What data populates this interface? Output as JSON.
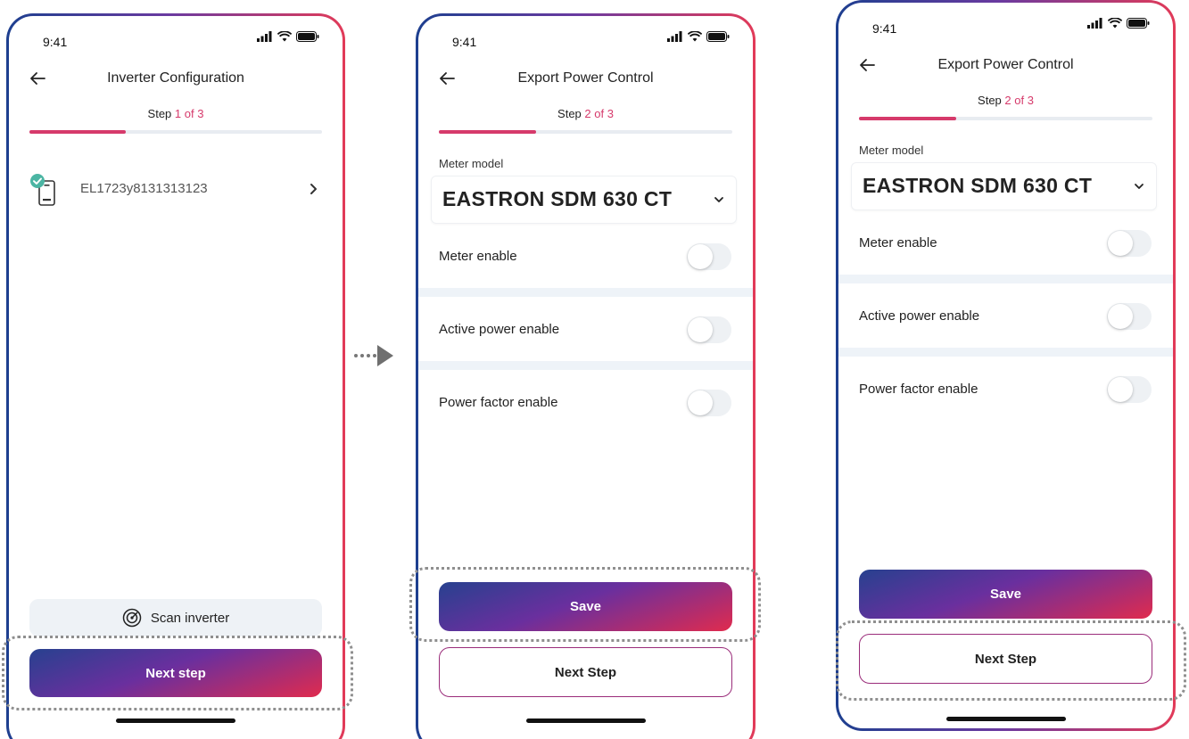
{
  "status_bar": {
    "time": "9:41"
  },
  "screen1": {
    "title": "Inverter Configuration",
    "step_prefix": "Step",
    "step_value": "1 of 3",
    "progress_fraction": 0.33,
    "device": {
      "id": "EL1723y8131313123"
    },
    "scan_button": "Scan inverter",
    "next_button": "Next step"
  },
  "screen2": {
    "title": "Export Power Control",
    "step_prefix": "Step",
    "step_value": "2 of 3",
    "progress_fraction": 0.33,
    "meter_label": "Meter model",
    "meter_value": "EASTRON SDM 630 CT",
    "toggles": [
      {
        "label": "Meter enable",
        "on": false
      },
      {
        "label": "Active power enable",
        "on": false
      },
      {
        "label": "Power factor enable",
        "on": false
      }
    ],
    "save_button": "Save",
    "next_button": "Next Step"
  },
  "screen3": {
    "title": "Export Power Control",
    "step_prefix": "Step",
    "step_value": "2 of 3",
    "progress_fraction": 0.33,
    "meter_label": "Meter model",
    "meter_value": "EASTRON SDM 630 CT",
    "toggles": [
      {
        "label": "Meter enable",
        "on": false
      },
      {
        "label": "Active power enable",
        "on": false
      },
      {
        "label": "Power factor enable",
        "on": false
      }
    ],
    "save_button": "Save",
    "next_button": "Next Step"
  },
  "colors": {
    "accent": "#d63a6b",
    "gradient_start": "#27418f",
    "gradient_end": "#e02b4e",
    "border_blue": "#1d3f8f"
  },
  "icons": [
    "back-arrow-icon",
    "signal-icon",
    "wifi-icon",
    "battery-icon",
    "device-icon",
    "check-badge-icon",
    "chevron-right-icon",
    "chevron-down-icon",
    "radar-icon",
    "flow-arrow-icon"
  ]
}
